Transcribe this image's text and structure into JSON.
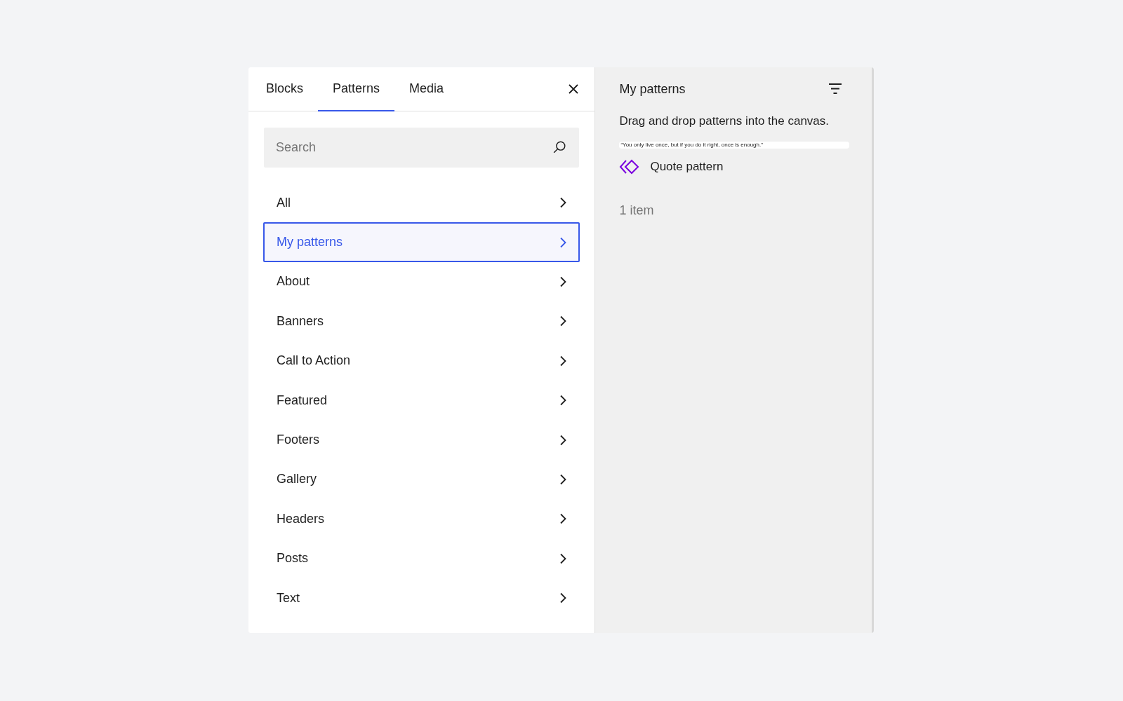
{
  "tabs": [
    {
      "label": "Blocks",
      "selected": false
    },
    {
      "label": "Patterns",
      "selected": true
    },
    {
      "label": "Media",
      "selected": false
    }
  ],
  "search": {
    "placeholder": "Search"
  },
  "categories": [
    {
      "label": "All",
      "selected": false
    },
    {
      "label": "My patterns",
      "selected": true
    },
    {
      "label": "About",
      "selected": false
    },
    {
      "label": "Banners",
      "selected": false
    },
    {
      "label": "Call to Action",
      "selected": false
    },
    {
      "label": "Featured",
      "selected": false
    },
    {
      "label": "Footers",
      "selected": false
    },
    {
      "label": "Gallery",
      "selected": false
    },
    {
      "label": "Headers",
      "selected": false
    },
    {
      "label": "Posts",
      "selected": false
    },
    {
      "label": "Text",
      "selected": false
    }
  ],
  "detail": {
    "title": "My patterns",
    "description": "Drag and drop patterns into the canvas.",
    "patterns": [
      {
        "preview": "“You only live once, but if you do it right, once is enough.”",
        "name": "Quote pattern"
      }
    ],
    "count": "1 item"
  }
}
